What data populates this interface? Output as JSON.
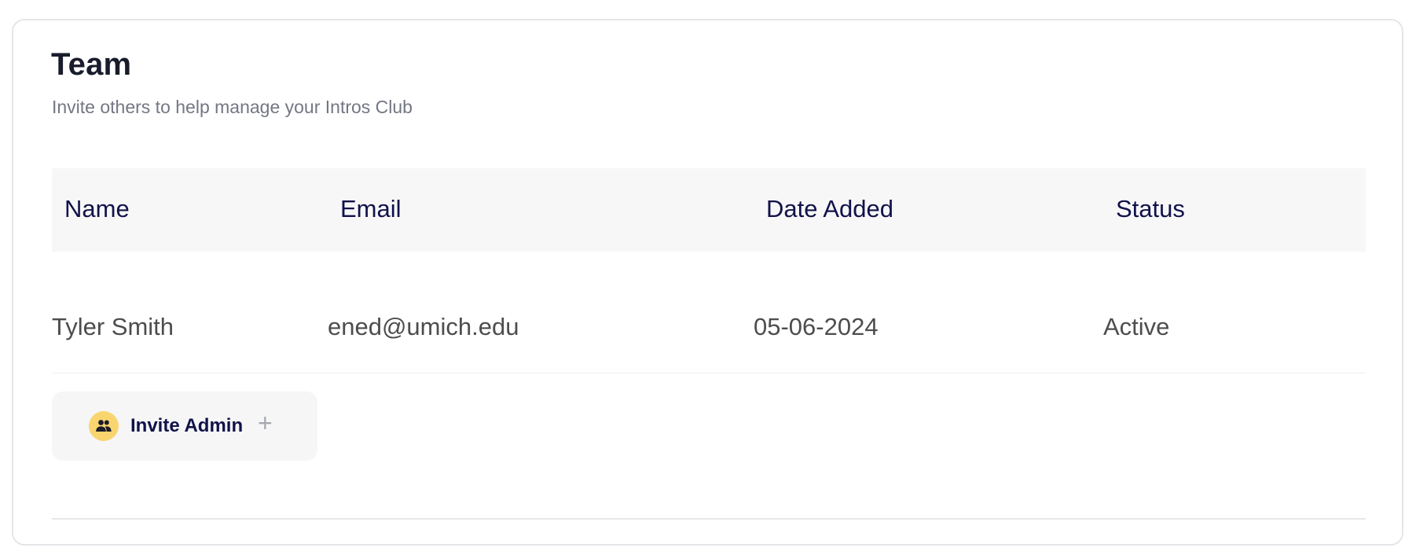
{
  "section": {
    "title": "Team",
    "subtitle": "Invite others to help manage your Intros Club"
  },
  "table": {
    "columns": [
      "Name",
      "Email",
      "Date Added",
      "Status"
    ],
    "rows": [
      {
        "name": "Tyler Smith",
        "email": "ened@umich.edu",
        "date_added": "05-06-2024",
        "status": "Active"
      }
    ]
  },
  "invite_button": {
    "label": "Invite Admin",
    "icon": "people-icon",
    "action_icon": "plus-icon",
    "icon_bg_color": "#f8d56f"
  },
  "colors": {
    "heading": "#181c2c",
    "header_text": "#11124a",
    "muted_text": "#737783",
    "header_bg": "#f7f7f7"
  }
}
